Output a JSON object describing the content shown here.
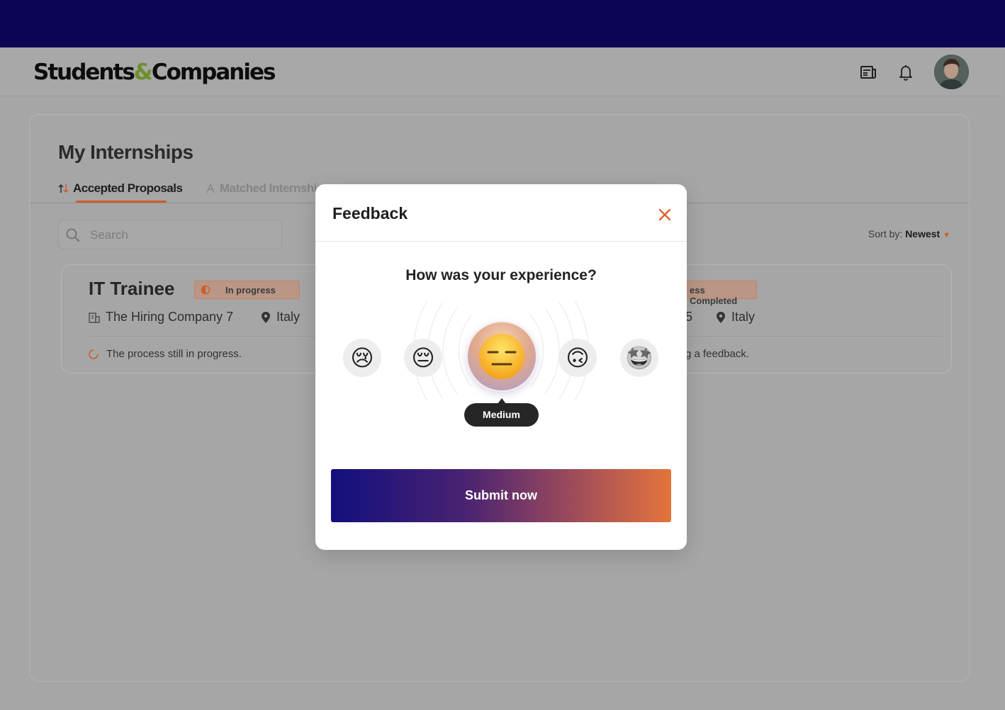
{
  "header": {
    "logo": {
      "part1": "Students",
      "amp": "&",
      "part2": "Companies"
    },
    "icons": [
      "newspaper-icon",
      "bell-icon"
    ],
    "avatar_alt": "user avatar"
  },
  "page": {
    "title": "My Internships",
    "tabs": [
      {
        "label": "Accepted Proposals",
        "active": true
      },
      {
        "label": "Matched Internship",
        "active": false
      }
    ],
    "search_placeholder": "Search",
    "sort_label": "Sort by:",
    "sort_value": "Newest"
  },
  "cards": [
    {
      "title": "IT Trainee",
      "badge": "In progress",
      "company": "The Hiring Company 7",
      "location": "Italy",
      "status": "The process still in progress."
    },
    {
      "badge": "ess Completed",
      "company": "5",
      "location": "Italy",
      "status": "g a feedback."
    }
  ],
  "modal": {
    "title": "Feedback",
    "question": "How was your experience?",
    "options": [
      {
        "emoji": "😢",
        "name": "very-sad"
      },
      {
        "emoji": "😔",
        "name": "sad"
      },
      {
        "emoji": "😑",
        "name": "medium"
      },
      {
        "emoji": "🙃",
        "name": "good"
      },
      {
        "emoji": "🤩",
        "name": "great"
      }
    ],
    "selected_label": "Medium",
    "submit_label": "Submit now"
  },
  "colors": {
    "top_band": "#0b0554",
    "accent": "#cf5c2a",
    "logo_amp": "#6e8f2a",
    "gradient_start": "#120f7d",
    "gradient_end": "#e4743c"
  }
}
